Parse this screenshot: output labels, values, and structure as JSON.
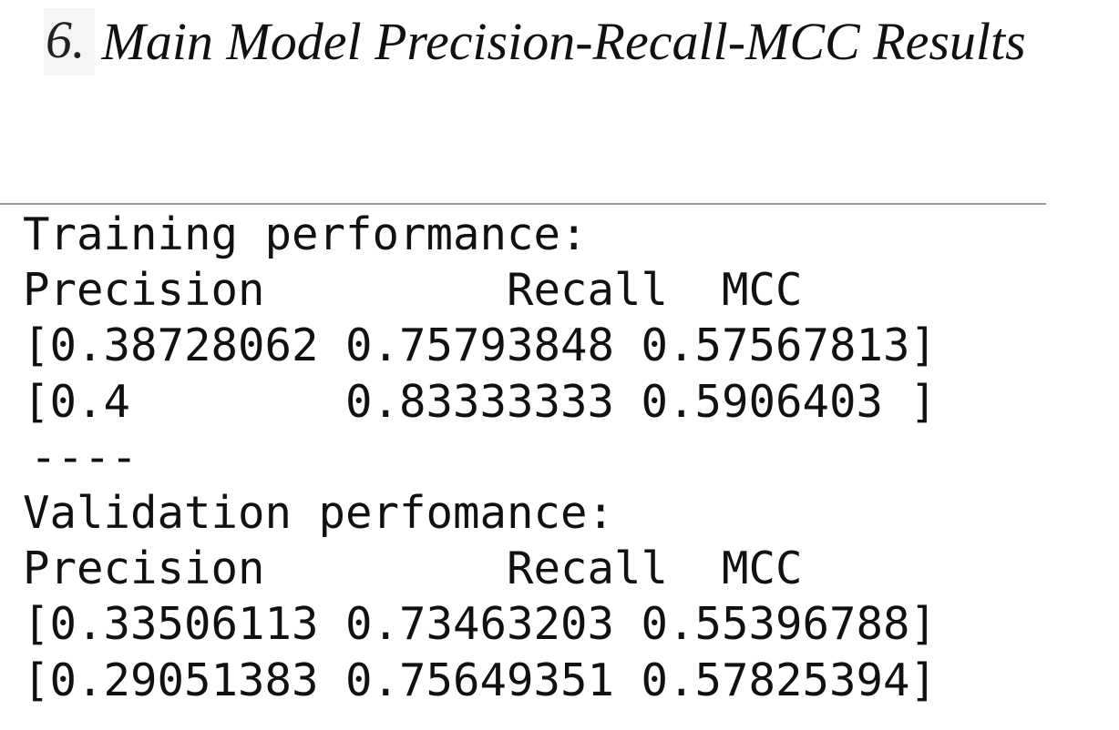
{
  "heading": {
    "number": "6.",
    "title": "Main Model Precision-Recall-MCC Results"
  },
  "console_lines": [
    "Training performance:",
    "Precision         Recall  MCC",
    "[0.38728062 0.75793848 0.57567813]",
    "[0.4        0.83333333 0.5906403 ]",
    "----",
    "Validation perfomance:",
    "Precision         Recall  MCC",
    "[0.33506113 0.73463203 0.55396788]",
    "[0.29051383 0.75649351 0.57825394]"
  ]
}
